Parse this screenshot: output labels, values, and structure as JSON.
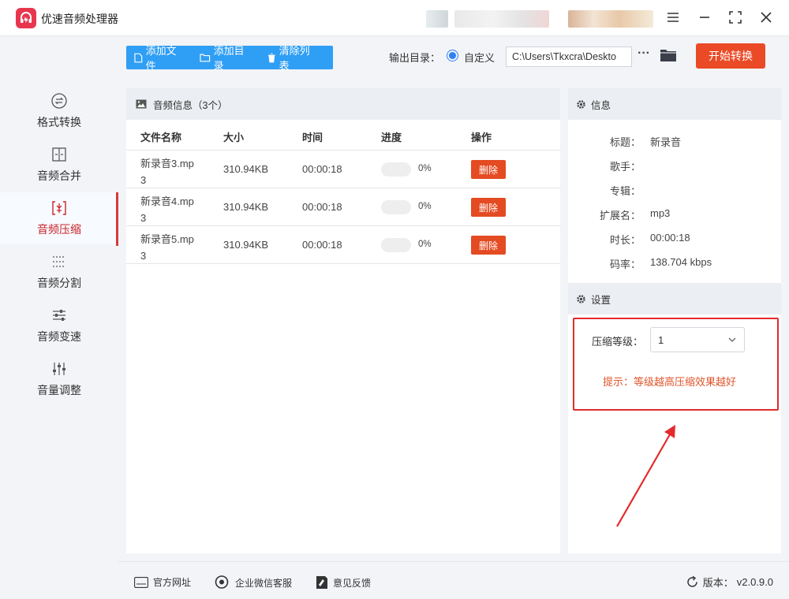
{
  "app": {
    "title": "优速音频处理器",
    "accent": "#e8364f"
  },
  "sidebar": {
    "items": [
      {
        "label": "格式转换",
        "icon": "format-convert-icon"
      },
      {
        "label": "音频合并",
        "icon": "merge-icon"
      },
      {
        "label": "音频压缩",
        "icon": "compress-icon",
        "active": true
      },
      {
        "label": "音频分割",
        "icon": "split-icon"
      },
      {
        "label": "音频变速",
        "icon": "speed-icon"
      },
      {
        "label": "音量调整",
        "icon": "volume-sliders-icon"
      }
    ]
  },
  "toolbar": {
    "add_file": "添加文件",
    "add_dir": "添加目录",
    "clear_list": "清除列表"
  },
  "output": {
    "label": "输出目录：",
    "option": "自定义",
    "path": "C:\\Users\\Tkxcra\\Deskto",
    "more": "···",
    "start": "开始转换"
  },
  "file_panel": {
    "title": "音频信息（3个）",
    "columns": {
      "name": "文件名称",
      "size": "大小",
      "time": "时间",
      "progress": "进度",
      "action": "操作"
    },
    "rows": [
      {
        "name": "新录音3.mp3",
        "size": "310.94KB",
        "time": "00:00:18",
        "progress": "0%",
        "action": "删除"
      },
      {
        "name": "新录音4.mp3",
        "size": "310.94KB",
        "time": "00:00:18",
        "progress": "0%",
        "action": "删除"
      },
      {
        "name": "新录音5.mp3",
        "size": "310.94KB",
        "time": "00:00:18",
        "progress": "0%",
        "action": "删除"
      }
    ]
  },
  "info": {
    "title": "信息",
    "fields": [
      {
        "key": "标题：",
        "value": "新录音"
      },
      {
        "key": "歌手：",
        "value": ""
      },
      {
        "key": "专辑：",
        "value": ""
      },
      {
        "key": "扩展名：",
        "value": "mp3"
      },
      {
        "key": "时长：",
        "value": "00:00:18"
      },
      {
        "key": "码率：",
        "value": "138.704 kbps"
      }
    ]
  },
  "settings": {
    "title": "设置",
    "level_label": "压缩等级：",
    "level_value": "1",
    "hint": "提示：等级越高压缩效果越好"
  },
  "footer": {
    "website": "官方网址",
    "wechat": "企业微信客服",
    "feedback": "意见反馈",
    "version_label": "版本：",
    "version": "v2.0.9.0"
  }
}
